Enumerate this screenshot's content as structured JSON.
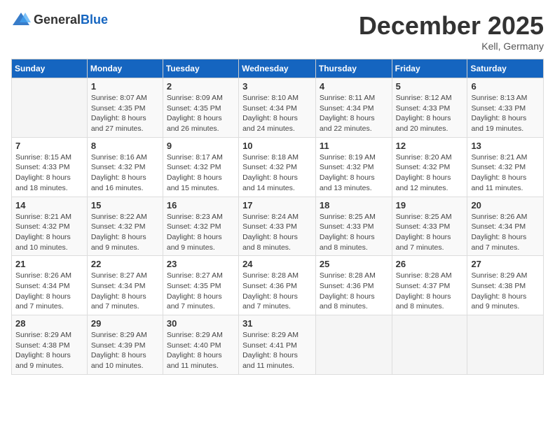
{
  "header": {
    "logo_general": "General",
    "logo_blue": "Blue",
    "month": "December 2025",
    "location": "Kell, Germany"
  },
  "weekdays": [
    "Sunday",
    "Monday",
    "Tuesday",
    "Wednesday",
    "Thursday",
    "Friday",
    "Saturday"
  ],
  "weeks": [
    [
      {
        "day": "",
        "sunrise": "",
        "sunset": "",
        "daylight": ""
      },
      {
        "day": "1",
        "sunrise": "Sunrise: 8:07 AM",
        "sunset": "Sunset: 4:35 PM",
        "daylight": "Daylight: 8 hours and 27 minutes."
      },
      {
        "day": "2",
        "sunrise": "Sunrise: 8:09 AM",
        "sunset": "Sunset: 4:35 PM",
        "daylight": "Daylight: 8 hours and 26 minutes."
      },
      {
        "day": "3",
        "sunrise": "Sunrise: 8:10 AM",
        "sunset": "Sunset: 4:34 PM",
        "daylight": "Daylight: 8 hours and 24 minutes."
      },
      {
        "day": "4",
        "sunrise": "Sunrise: 8:11 AM",
        "sunset": "Sunset: 4:34 PM",
        "daylight": "Daylight: 8 hours and 22 minutes."
      },
      {
        "day": "5",
        "sunrise": "Sunrise: 8:12 AM",
        "sunset": "Sunset: 4:33 PM",
        "daylight": "Daylight: 8 hours and 20 minutes."
      },
      {
        "day": "6",
        "sunrise": "Sunrise: 8:13 AM",
        "sunset": "Sunset: 4:33 PM",
        "daylight": "Daylight: 8 hours and 19 minutes."
      }
    ],
    [
      {
        "day": "7",
        "sunrise": "Sunrise: 8:15 AM",
        "sunset": "Sunset: 4:33 PM",
        "daylight": "Daylight: 8 hours and 18 minutes."
      },
      {
        "day": "8",
        "sunrise": "Sunrise: 8:16 AM",
        "sunset": "Sunset: 4:32 PM",
        "daylight": "Daylight: 8 hours and 16 minutes."
      },
      {
        "day": "9",
        "sunrise": "Sunrise: 8:17 AM",
        "sunset": "Sunset: 4:32 PM",
        "daylight": "Daylight: 8 hours and 15 minutes."
      },
      {
        "day": "10",
        "sunrise": "Sunrise: 8:18 AM",
        "sunset": "Sunset: 4:32 PM",
        "daylight": "Daylight: 8 hours and 14 minutes."
      },
      {
        "day": "11",
        "sunrise": "Sunrise: 8:19 AM",
        "sunset": "Sunset: 4:32 PM",
        "daylight": "Daylight: 8 hours and 13 minutes."
      },
      {
        "day": "12",
        "sunrise": "Sunrise: 8:20 AM",
        "sunset": "Sunset: 4:32 PM",
        "daylight": "Daylight: 8 hours and 12 minutes."
      },
      {
        "day": "13",
        "sunrise": "Sunrise: 8:21 AM",
        "sunset": "Sunset: 4:32 PM",
        "daylight": "Daylight: 8 hours and 11 minutes."
      }
    ],
    [
      {
        "day": "14",
        "sunrise": "Sunrise: 8:21 AM",
        "sunset": "Sunset: 4:32 PM",
        "daylight": "Daylight: 8 hours and 10 minutes."
      },
      {
        "day": "15",
        "sunrise": "Sunrise: 8:22 AM",
        "sunset": "Sunset: 4:32 PM",
        "daylight": "Daylight: 8 hours and 9 minutes."
      },
      {
        "day": "16",
        "sunrise": "Sunrise: 8:23 AM",
        "sunset": "Sunset: 4:32 PM",
        "daylight": "Daylight: 8 hours and 9 minutes."
      },
      {
        "day": "17",
        "sunrise": "Sunrise: 8:24 AM",
        "sunset": "Sunset: 4:33 PM",
        "daylight": "Daylight: 8 hours and 8 minutes."
      },
      {
        "day": "18",
        "sunrise": "Sunrise: 8:25 AM",
        "sunset": "Sunset: 4:33 PM",
        "daylight": "Daylight: 8 hours and 8 minutes."
      },
      {
        "day": "19",
        "sunrise": "Sunrise: 8:25 AM",
        "sunset": "Sunset: 4:33 PM",
        "daylight": "Daylight: 8 hours and 7 minutes."
      },
      {
        "day": "20",
        "sunrise": "Sunrise: 8:26 AM",
        "sunset": "Sunset: 4:34 PM",
        "daylight": "Daylight: 8 hours and 7 minutes."
      }
    ],
    [
      {
        "day": "21",
        "sunrise": "Sunrise: 8:26 AM",
        "sunset": "Sunset: 4:34 PM",
        "daylight": "Daylight: 8 hours and 7 minutes."
      },
      {
        "day": "22",
        "sunrise": "Sunrise: 8:27 AM",
        "sunset": "Sunset: 4:34 PM",
        "daylight": "Daylight: 8 hours and 7 minutes."
      },
      {
        "day": "23",
        "sunrise": "Sunrise: 8:27 AM",
        "sunset": "Sunset: 4:35 PM",
        "daylight": "Daylight: 8 hours and 7 minutes."
      },
      {
        "day": "24",
        "sunrise": "Sunrise: 8:28 AM",
        "sunset": "Sunset: 4:36 PM",
        "daylight": "Daylight: 8 hours and 7 minutes."
      },
      {
        "day": "25",
        "sunrise": "Sunrise: 8:28 AM",
        "sunset": "Sunset: 4:36 PM",
        "daylight": "Daylight: 8 hours and 8 minutes."
      },
      {
        "day": "26",
        "sunrise": "Sunrise: 8:28 AM",
        "sunset": "Sunset: 4:37 PM",
        "daylight": "Daylight: 8 hours and 8 minutes."
      },
      {
        "day": "27",
        "sunrise": "Sunrise: 8:29 AM",
        "sunset": "Sunset: 4:38 PM",
        "daylight": "Daylight: 8 hours and 9 minutes."
      }
    ],
    [
      {
        "day": "28",
        "sunrise": "Sunrise: 8:29 AM",
        "sunset": "Sunset: 4:38 PM",
        "daylight": "Daylight: 8 hours and 9 minutes."
      },
      {
        "day": "29",
        "sunrise": "Sunrise: 8:29 AM",
        "sunset": "Sunset: 4:39 PM",
        "daylight": "Daylight: 8 hours and 10 minutes."
      },
      {
        "day": "30",
        "sunrise": "Sunrise: 8:29 AM",
        "sunset": "Sunset: 4:40 PM",
        "daylight": "Daylight: 8 hours and 11 minutes."
      },
      {
        "day": "31",
        "sunrise": "Sunrise: 8:29 AM",
        "sunset": "Sunset: 4:41 PM",
        "daylight": "Daylight: 8 hours and 11 minutes."
      },
      {
        "day": "",
        "sunrise": "",
        "sunset": "",
        "daylight": ""
      },
      {
        "day": "",
        "sunrise": "",
        "sunset": "",
        "daylight": ""
      },
      {
        "day": "",
        "sunrise": "",
        "sunset": "",
        "daylight": ""
      }
    ]
  ]
}
